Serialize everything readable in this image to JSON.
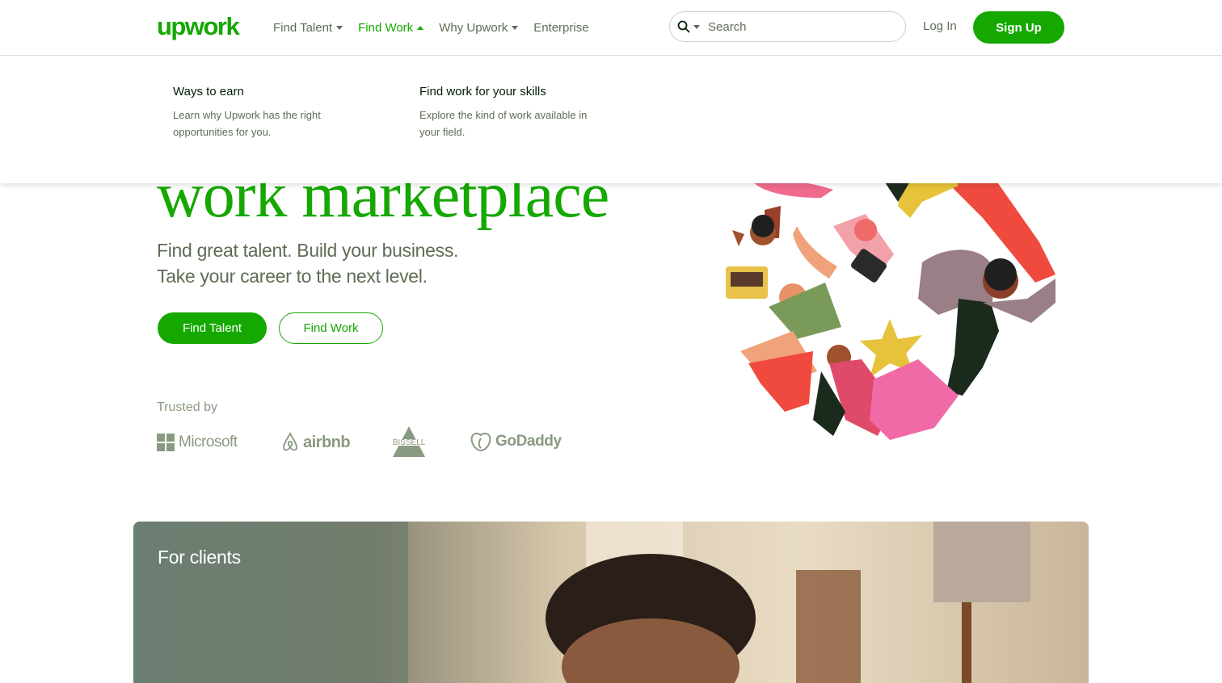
{
  "header": {
    "logo_text": "upwork",
    "nav": [
      {
        "label": "Find Talent",
        "caret": "down",
        "active": false
      },
      {
        "label": "Find Work",
        "caret": "up",
        "active": true
      },
      {
        "label": "Why Upwork",
        "caret": "down",
        "active": false
      },
      {
        "label": "Enterprise",
        "caret": "",
        "active": false
      }
    ],
    "search_placeholder": "Search",
    "login_label": "Log In",
    "signup_label": "Sign Up"
  },
  "dropdown": {
    "items": [
      {
        "title": "Ways to earn",
        "desc": "Learn why Upwork has the right opportunities for you."
      },
      {
        "title": "Find work for your skills",
        "desc": "Explore the kind of work available in your field."
      }
    ]
  },
  "hero": {
    "title": "work marketplace",
    "subtitle_line1": "Find great talent. Build your business.",
    "subtitle_line2": "Take your career to the next level.",
    "find_talent_label": "Find Talent",
    "find_work_label": "Find Work",
    "trusted_label": "Trusted by",
    "brands": [
      "Microsoft",
      "airbnb",
      "BISSELL",
      "GoDaddy"
    ]
  },
  "clients": {
    "label": "For clients"
  },
  "colors": {
    "brand_green": "#14a800",
    "text_muted": "#5e6d55",
    "logo_gray": "#8a9a82"
  }
}
